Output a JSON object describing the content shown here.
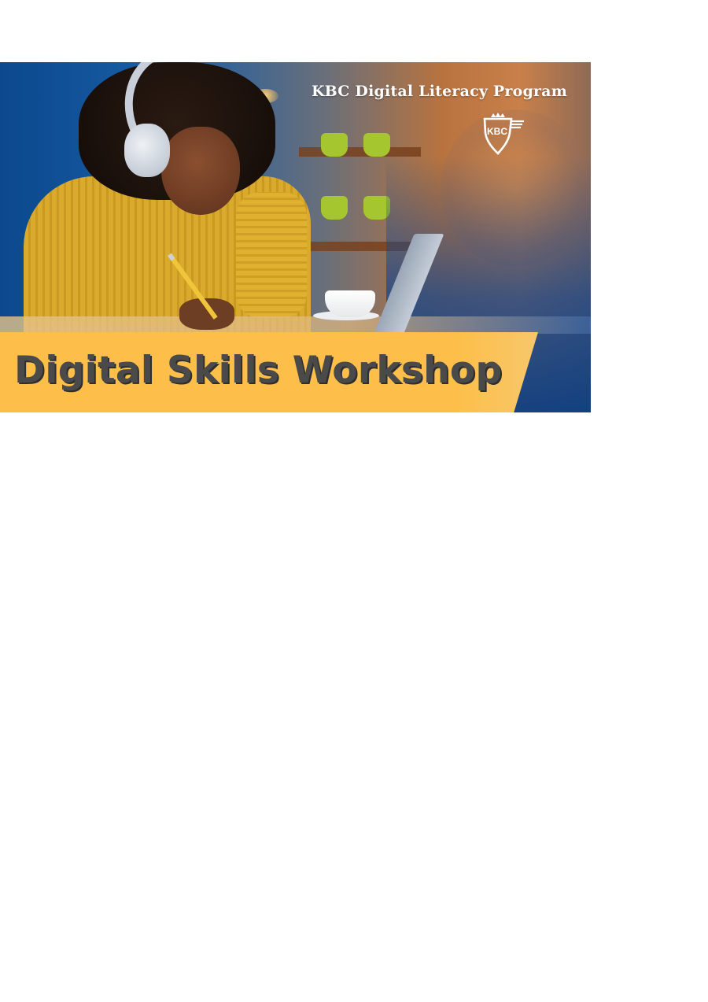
{
  "banner": {
    "program_title": "KBC Digital Literacy Program",
    "logo_text": "KBC",
    "headline": "Digital Skills Workshop",
    "colors": {
      "band": "#fdbf4a",
      "headline_text": "#4b4a4b",
      "blue": "#0e4d91"
    }
  }
}
